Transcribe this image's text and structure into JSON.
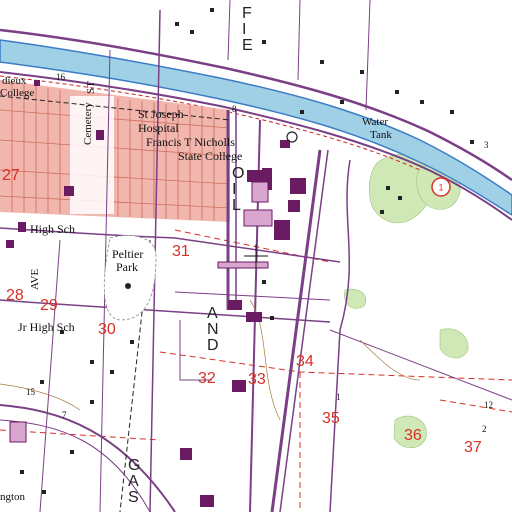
{
  "map": {
    "labels": {
      "st_joseph": "St Joseph",
      "hospital": "Hospital",
      "francis": "Francis T Nicholls",
      "state_college": "State College",
      "cemetery": "Cemetery",
      "water": "Water",
      "tank": "Tank",
      "high_sch": "High Sch",
      "peltier": "Peltier",
      "park": "Park",
      "jr_high": "Jr High Sch",
      "ave": "AVE",
      "st": "ST",
      "college_frag": "College",
      "dieux_frag": "dieux",
      "washington_frag": "ngton",
      "route_1": "1"
    },
    "road_letters": {
      "oil": [
        "O",
        "I",
        "L"
      ],
      "and": [
        "A",
        "N",
        "D"
      ],
      "gas": [
        "G",
        "A",
        "S"
      ],
      "field": [
        "F",
        "I",
        "E"
      ]
    },
    "sections": [
      "27",
      "28",
      "29",
      "30",
      "31",
      "32",
      "33",
      "34",
      "35",
      "36",
      "37"
    ],
    "small_numbers": [
      "16",
      "15",
      "2",
      "3",
      "7",
      "12",
      "8",
      "1"
    ],
    "colors": {
      "canal": "#9fd0e6",
      "canal_edge": "#3b7cc4",
      "urban": "#f1b6ad",
      "urban_grid": "#c65b4c",
      "building": "#6a1b62",
      "vegetation": "#cfe8b5",
      "roads": "#7b3f86",
      "section_lines": "#d93025",
      "contour": "#a57a3a"
    }
  }
}
